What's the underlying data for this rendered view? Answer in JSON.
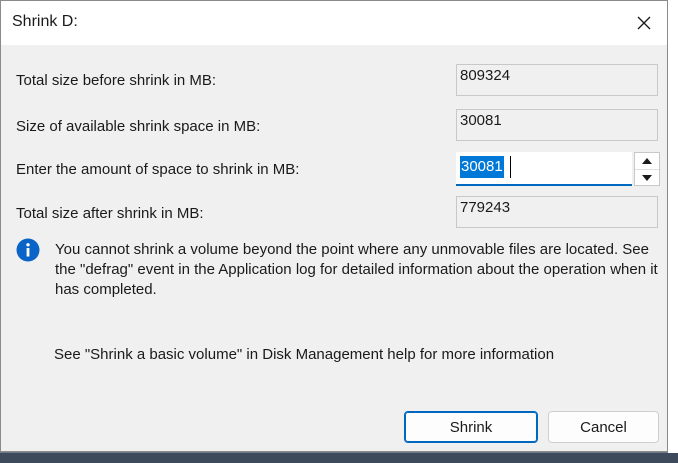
{
  "window": {
    "title": "Shrink D:"
  },
  "fields": {
    "total_before_label": "Total size before shrink in MB:",
    "total_before_value": "809324",
    "available_label": "Size of available shrink space in MB:",
    "available_value": "30081",
    "amount_label": "Enter the amount of space to shrink in MB:",
    "amount_value": "30081",
    "total_after_label": "Total size after shrink in MB:",
    "total_after_value": "779243"
  },
  "info": {
    "icon": "info-icon",
    "message": "You cannot shrink a volume beyond the point where any unmovable files are located. See the \"defrag\" event in the Application log for detailed information about the operation when it has completed."
  },
  "help": {
    "text": "See \"Shrink a basic volume\" in Disk Management help for more information"
  },
  "buttons": {
    "shrink_label": "Shrink",
    "cancel_label": "Cancel"
  },
  "colors": {
    "accent": "#0067c0",
    "selection": "#0078d7",
    "info_icon": "#0a64c8"
  }
}
